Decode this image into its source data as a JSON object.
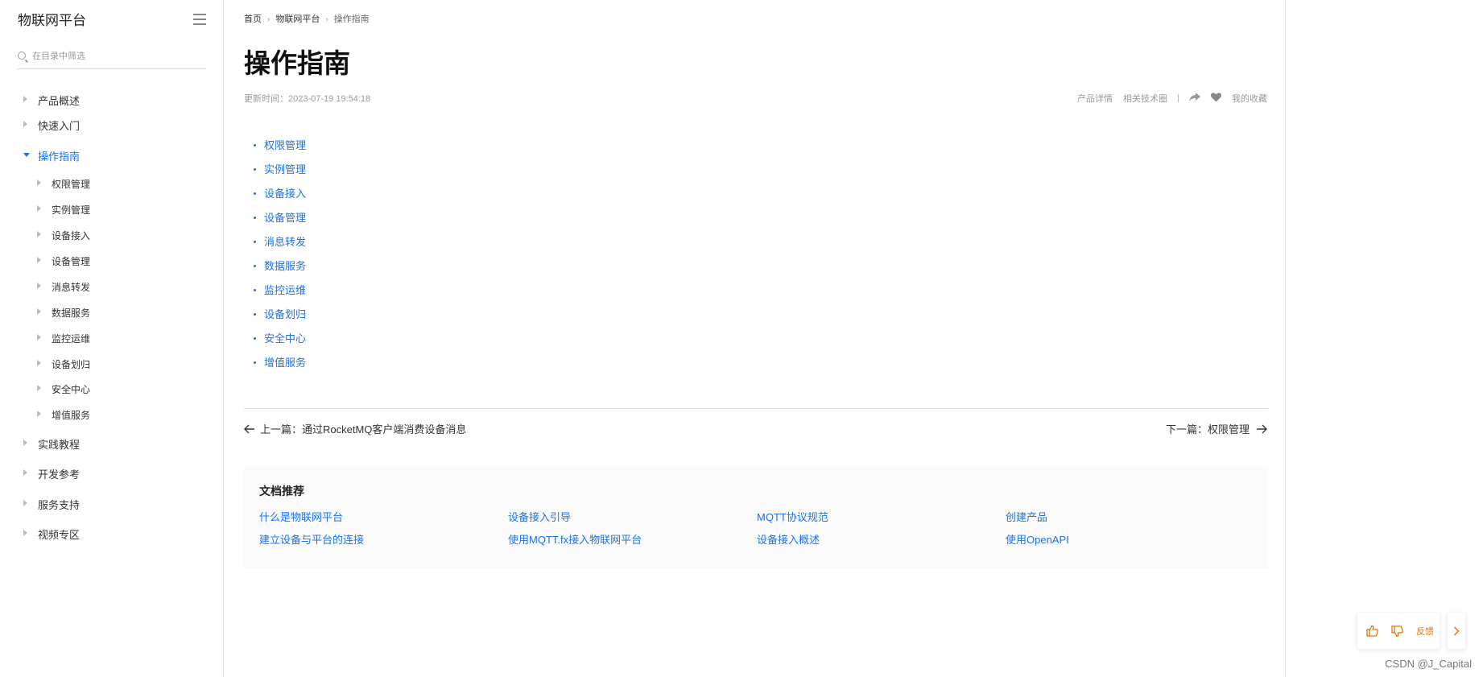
{
  "sidebar": {
    "title": "物联网平台",
    "search_placeholder": "在目录中筛选",
    "items": [
      {
        "label": "产品概述",
        "level": 1,
        "expanded": false
      },
      {
        "label": "快速入门",
        "level": 1,
        "expanded": false
      },
      {
        "label": "操作指南",
        "level": 1,
        "expanded": true,
        "active": true
      },
      {
        "label": "权限管理",
        "level": 2
      },
      {
        "label": "实例管理",
        "level": 2
      },
      {
        "label": "设备接入",
        "level": 2
      },
      {
        "label": "设备管理",
        "level": 2
      },
      {
        "label": "消息转发",
        "level": 2
      },
      {
        "label": "数据服务",
        "level": 2
      },
      {
        "label": "监控运维",
        "level": 2
      },
      {
        "label": "设备划归",
        "level": 2
      },
      {
        "label": "安全中心",
        "level": 2
      },
      {
        "label": "增值服务",
        "level": 2
      },
      {
        "label": "实践教程",
        "level": 1,
        "expanded": false
      },
      {
        "label": "开发参考",
        "level": 1,
        "expanded": false
      },
      {
        "label": "服务支持",
        "level": 1,
        "expanded": false
      },
      {
        "label": "视频专区",
        "level": 1,
        "expanded": false
      }
    ]
  },
  "breadcrumb": {
    "home": "首页",
    "parent": "物联网平台",
    "current": "操作指南"
  },
  "page": {
    "title": "操作指南",
    "updated": "更新时间：2023-07-19 19:54:18",
    "actions": {
      "product_detail": "产品详情",
      "related_tech": "相关技术圈",
      "favorites": "我的收藏"
    }
  },
  "toc": [
    "权限管理",
    "实例管理",
    "设备接入",
    "设备管理",
    "消息转发",
    "数据服务",
    "监控运维",
    "设备划归",
    "安全中心",
    "增值服务"
  ],
  "pager": {
    "prev": "上一篇：通过RocketMQ客户端消费设备消息",
    "next": "下一篇：权限管理"
  },
  "recommend": {
    "title": "文档推荐",
    "links": [
      [
        "什么是物联网平台",
        "设备接入引导",
        "MQTT协议规范",
        "创建产品"
      ],
      [
        "建立设备与平台的连接",
        "使用MQTT.fx接入物联网平台",
        "设备接入概述",
        "使用OpenAPI"
      ]
    ]
  },
  "feedback": {
    "label": "反馈"
  },
  "watermark": "CSDN @J_Capital",
  "colors": {
    "link": "#1a73e8",
    "feedback_accent": "#e8730c"
  },
  "icons": [
    "menu-icon",
    "search-icon",
    "share-icon",
    "heart-icon",
    "arrow-left-icon",
    "arrow-right-icon",
    "thumbs-up-icon",
    "thumbs-down-icon",
    "chevron-right-icon"
  ]
}
